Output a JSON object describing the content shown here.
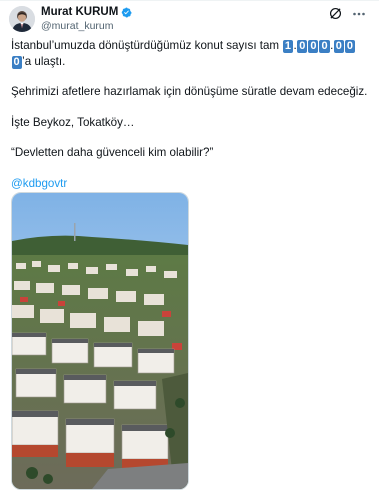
{
  "tweet": {
    "author_name": "Murat KURUM",
    "author_handle": "@murat_kurum",
    "line1_prefix": "İstanbul’umuzda dönüştürdüğümüz konut sayısı tam ",
    "number_digits": [
      "1",
      ".",
      "0",
      "0",
      "0",
      ".",
      "0",
      "0",
      "0"
    ],
    "line2_suffix": "’a ulaştı.",
    "para2": "Şehrimizi afetlere hazırlamak için dönüşüme süratle devam edeceğiz.",
    "para3": "İşte Beykoz, Tokatköy…",
    "para4": "“Devletten daha güvenceli kim olabilir?”",
    "mention": "@kdbgovtr"
  },
  "icons": {
    "verified": "verified-badge-icon",
    "grok": "grok-icon",
    "more": "more-options-icon"
  },
  "colors": {
    "digit_bg": "#3b7fc4",
    "link": "#1d9bf0",
    "verified": "#1d9bf0"
  }
}
